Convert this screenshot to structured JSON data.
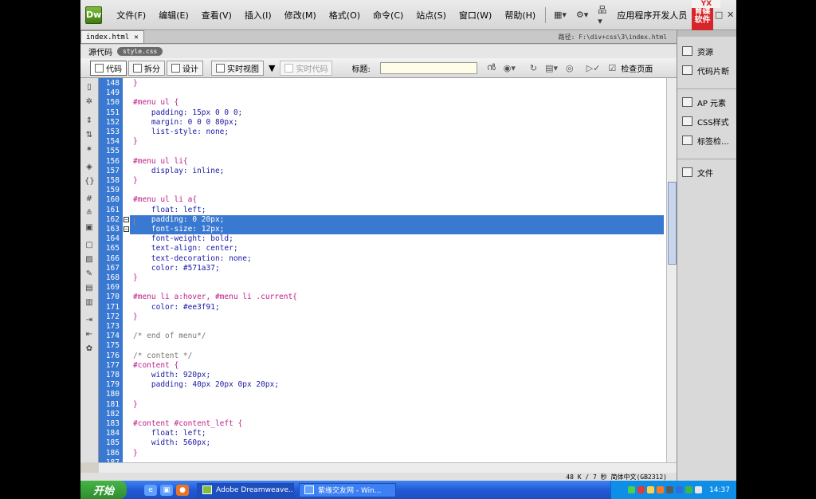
{
  "app": {
    "logo": "Dw",
    "menus": [
      "文件(F)",
      "编辑(E)",
      "查看(V)",
      "插入(I)",
      "修改(M)",
      "格式(O)",
      "命令(C)",
      "站点(S)",
      "窗口(W)",
      "帮助(H)"
    ],
    "workspace": "应用程序开发人员",
    "brand_top": "YX",
    "brand_text": "育碟软件"
  },
  "document": {
    "tab_name": "index.html",
    "path": "路径: F:\\div+css\\3\\index.html",
    "related_label": "源代码",
    "related_file": "style.css"
  },
  "toolbar": {
    "code_label": "代码",
    "split_label": "拆分",
    "design_label": "设计",
    "live_view_label": "实时视图",
    "live_code_label": "实时代码",
    "title_label": "标题:",
    "title_value": "",
    "check_page_label": "检查页面"
  },
  "code": {
    "lines": [
      {
        "n": "148",
        "t": "}",
        "k": "punc"
      },
      {
        "n": "149",
        "t": "",
        "k": "punc"
      },
      {
        "n": "150",
        "t": "#menu ul {",
        "k": "sel"
      },
      {
        "n": "151",
        "t": "    padding: 15px 0 0 0;",
        "k": "prop"
      },
      {
        "n": "152",
        "t": "    margin: 0 0 0 80px;",
        "k": "prop"
      },
      {
        "n": "153",
        "t": "    list-style: none;",
        "k": "prop"
      },
      {
        "n": "154",
        "t": "}",
        "k": "punc"
      },
      {
        "n": "155",
        "t": "",
        "k": "punc"
      },
      {
        "n": "156",
        "t": "#menu ul li{",
        "k": "sel"
      },
      {
        "n": "157",
        "t": "    display: inline;",
        "k": "prop"
      },
      {
        "n": "158",
        "t": "}",
        "k": "punc"
      },
      {
        "n": "159",
        "t": "",
        "k": "punc"
      },
      {
        "n": "160",
        "t": "#menu ul li a{",
        "k": "sel"
      },
      {
        "n": "161",
        "t": "    float: left;",
        "k": "prop"
      },
      {
        "n": "162",
        "t": "    padding: 0 20px;",
        "k": "prop",
        "sel": true
      },
      {
        "n": "163",
        "t": "    font-size: 12px;",
        "k": "prop",
        "sel": true
      },
      {
        "n": "164",
        "t": "    font-weight: bold;",
        "k": "prop"
      },
      {
        "n": "165",
        "t": "    text-align: center;",
        "k": "prop"
      },
      {
        "n": "166",
        "t": "    text-decoration: none;",
        "k": "prop"
      },
      {
        "n": "167",
        "t": "    color: #571a37;",
        "k": "prop"
      },
      {
        "n": "168",
        "t": "}",
        "k": "punc"
      },
      {
        "n": "169",
        "t": "",
        "k": "punc"
      },
      {
        "n": "170",
        "t": "#menu li a:hover, #menu li .current{",
        "k": "sel"
      },
      {
        "n": "171",
        "t": "    color: #ee3f91;",
        "k": "prop"
      },
      {
        "n": "172",
        "t": "}",
        "k": "punc"
      },
      {
        "n": "173",
        "t": "",
        "k": "punc"
      },
      {
        "n": "174",
        "t": "/* end of menu*/",
        "k": "com"
      },
      {
        "n": "175",
        "t": "",
        "k": "punc"
      },
      {
        "n": "176",
        "t": "/* content */",
        "k": "com"
      },
      {
        "n": "177",
        "t": "#content {",
        "k": "sel"
      },
      {
        "n": "178",
        "t": "    width: 920px;",
        "k": "prop"
      },
      {
        "n": "179",
        "t": "    padding: 40px 20px 0px 20px;",
        "k": "prop"
      },
      {
        "n": "180",
        "t": "",
        "k": "punc"
      },
      {
        "n": "181",
        "t": "}",
        "k": "punc"
      },
      {
        "n": "182",
        "t": "",
        "k": "punc"
      },
      {
        "n": "183",
        "t": "#content #content_left {",
        "k": "sel"
      },
      {
        "n": "184",
        "t": "    float: left;",
        "k": "prop"
      },
      {
        "n": "185",
        "t": "    width: 560px;",
        "k": "prop"
      },
      {
        "n": "186",
        "t": "}",
        "k": "punc"
      },
      {
        "n": "187",
        "t": "",
        "k": "punc"
      }
    ]
  },
  "status": {
    "text": "48 K / 7 秒 简体中文(GB2312)"
  },
  "panel": {
    "items": [
      "资源",
      "代码片断",
      "AP 元素",
      "CSS样式",
      "标签检…",
      "文件"
    ]
  },
  "taskbar": {
    "start_label": "开始",
    "tasks": [
      "Adobe Dreamweave...",
      "紫缘交友网 - Win..."
    ],
    "clock": "14:37"
  }
}
